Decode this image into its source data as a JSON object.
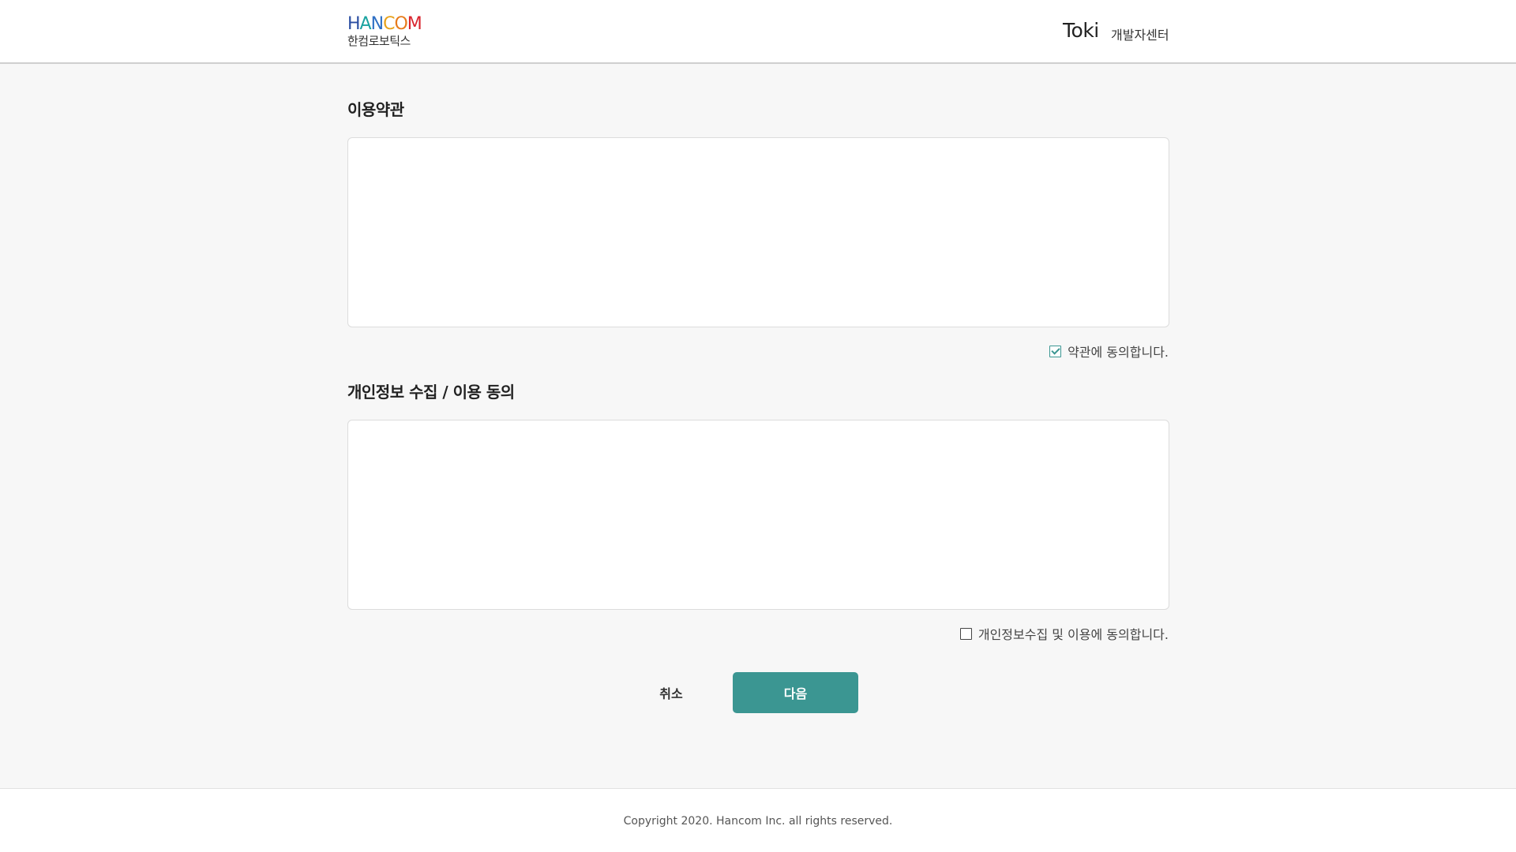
{
  "header": {
    "logo_letters": [
      {
        "ch": "H",
        "color": "#2b4ea2"
      },
      {
        "ch": "A",
        "color": "#1aa3a0"
      },
      {
        "ch": "N",
        "color": "#2e6fc4"
      },
      {
        "ch": "C",
        "color": "#e8a21a"
      },
      {
        "ch": "O",
        "color": "#e77b1c"
      },
      {
        "ch": "M",
        "color": "#d9232d"
      }
    ],
    "logo_sub": "한컴로보틱스",
    "brand": "Toki",
    "dev_center": "개발자센터"
  },
  "terms": {
    "title": "이용약관",
    "content": "",
    "agree_label": "약관에 동의합니다.",
    "agreed": true
  },
  "privacy": {
    "title": "개인정보 수집 / 이용 동의",
    "content": "",
    "agree_label": "개인정보수집 및 이용에 동의합니다.",
    "agreed": false
  },
  "actions": {
    "cancel_label": "취소",
    "next_label": "다음"
  },
  "colors": {
    "accent": "#3b9692"
  },
  "footer": {
    "copyright": "Copyright 2020. Hancom Inc. all rights reserved."
  }
}
